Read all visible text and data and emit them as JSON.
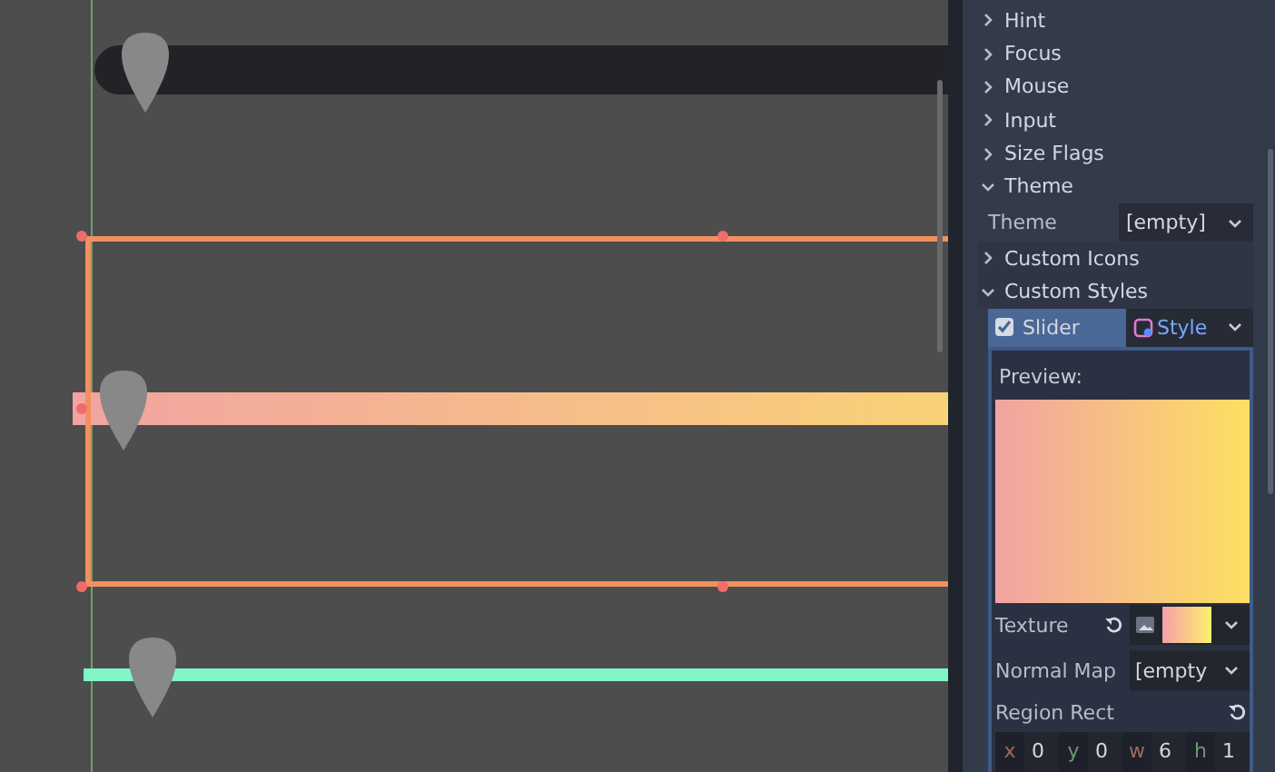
{
  "canvas": {
    "sliders": [
      {
        "kind": "dark",
        "level": 0.03,
        "selected": false
      },
      {
        "kind": "gradient",
        "level": 0.03,
        "selected": true
      },
      {
        "kind": "green",
        "level": 0.05,
        "selected": false
      }
    ]
  },
  "inspector": {
    "sections": [
      {
        "label": "Hint",
        "expanded": false
      },
      {
        "label": "Focus",
        "expanded": false
      },
      {
        "label": "Mouse",
        "expanded": false
      },
      {
        "label": "Input",
        "expanded": false
      },
      {
        "label": "Size Flags",
        "expanded": false
      },
      {
        "label": "Theme",
        "expanded": true
      }
    ],
    "theme_property": {
      "label": "Theme",
      "value": "[empty]"
    },
    "subsections": [
      {
        "label": "Custom Icons",
        "expanded": false
      },
      {
        "label": "Custom Styles",
        "expanded": true
      }
    ],
    "style_override": {
      "label": "Slider",
      "checked": true,
      "value": "Style"
    },
    "preview_label": "Preview:",
    "properties": [
      {
        "kind": "texture",
        "label": "Texture"
      },
      {
        "kind": "resource",
        "label": "Normal Map",
        "value": "[empty"
      }
    ],
    "region_rect": {
      "label": "Region Rect",
      "fields": [
        {
          "axis": "x",
          "value": "0"
        },
        {
          "axis": "y",
          "value": "0"
        },
        {
          "axis": "w",
          "value": "6"
        },
        {
          "axis": "h",
          "value": "1"
        }
      ]
    }
  }
}
